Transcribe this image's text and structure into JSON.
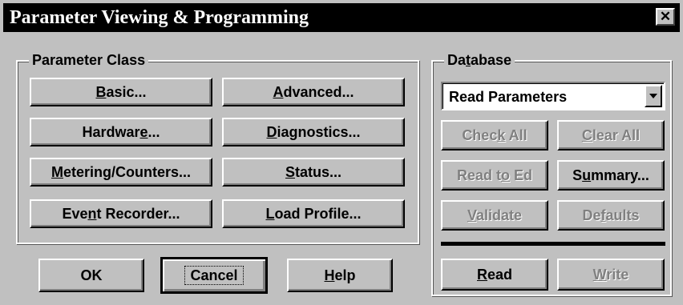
{
  "window": {
    "title": "Parameter Viewing & Programming",
    "close_symbol": "✕"
  },
  "parameter_class": {
    "label": "Parameter Class",
    "buttons": {
      "basic": {
        "pre": "",
        "key": "B",
        "post": "asic..."
      },
      "advanced": {
        "pre": "",
        "key": "A",
        "post": "dvanced..."
      },
      "hardware": {
        "pre": "Hardwar",
        "key": "e",
        "post": "..."
      },
      "diagnostics": {
        "pre": "",
        "key": "D",
        "post": "iagnostics..."
      },
      "metering": {
        "pre": "",
        "key": "M",
        "post": "etering/Counters..."
      },
      "status": {
        "pre": "",
        "key": "S",
        "post": "tatus..."
      },
      "event": {
        "pre": "Eve",
        "key": "n",
        "post": "t Recorder..."
      },
      "load": {
        "pre": "",
        "key": "L",
        "post": "oad Profile..."
      }
    }
  },
  "dialog_buttons": {
    "ok": {
      "label": "OK"
    },
    "cancel": {
      "label": "Cancel"
    },
    "help": {
      "pre": "",
      "key": "H",
      "post": "elp"
    }
  },
  "database": {
    "label_pre": "Da",
    "label_key": "t",
    "label_post": "abase",
    "dropdown_value": "Read Parameters",
    "buttons": {
      "check_all": {
        "pre": "Chec",
        "key": "k",
        "post": " All",
        "enabled": false
      },
      "clear_all": {
        "pre": "",
        "key": "C",
        "post": "lear All",
        "enabled": false
      },
      "read_to_ed": {
        "pre": "Read t",
        "key": "o",
        "post": " Ed",
        "enabled": false
      },
      "summary": {
        "pre": "S",
        "key": "u",
        "post": "mmary...",
        "enabled": true
      },
      "validate": {
        "pre": "",
        "key": "V",
        "post": "alidate",
        "enabled": false
      },
      "defaults": {
        "pre": "De",
        "key": "f",
        "post": "aults",
        "enabled": false
      },
      "read": {
        "pre": "",
        "key": "R",
        "post": "ead",
        "enabled": true
      },
      "write": {
        "pre": "",
        "key": "W",
        "post": "rite",
        "enabled": false
      }
    }
  }
}
